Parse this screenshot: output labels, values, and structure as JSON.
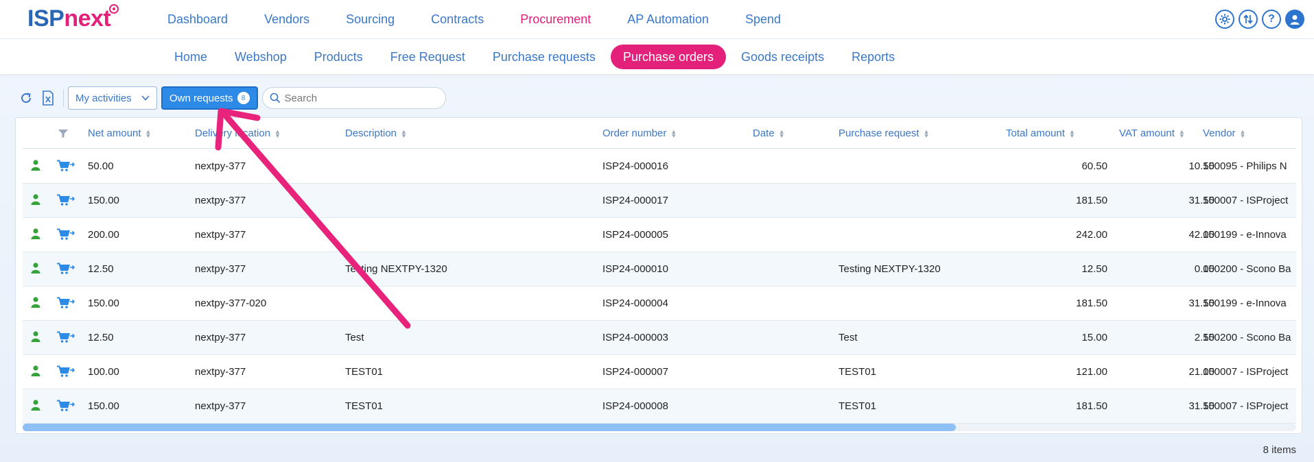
{
  "brand": {
    "isp": "ISP",
    "next": "next"
  },
  "main_nav": [
    "Dashboard",
    "Vendors",
    "Sourcing",
    "Contracts",
    "Procurement",
    "AP Automation",
    "Spend"
  ],
  "main_nav_active": "Procurement",
  "sub_nav": [
    "Home",
    "Webshop",
    "Products",
    "Free Request",
    "Purchase requests",
    "Purchase orders",
    "Goods receipts",
    "Reports"
  ],
  "sub_nav_active": "Purchase orders",
  "toolbar": {
    "activities_label": "My activities",
    "own_requests_label": "Own requests",
    "own_requests_count": "8",
    "search_placeholder": "Search"
  },
  "columns": {
    "net_amount": "Net amount",
    "delivery_location": "Delivery location",
    "description": "Description",
    "order_number": "Order number",
    "date": "Date",
    "purchase_request": "Purchase request",
    "total_amount": "Total amount",
    "vat_amount": "VAT amount",
    "vendor": "Vendor"
  },
  "rows": [
    {
      "net": "50.00",
      "loc": "nextpy-377",
      "desc": "",
      "order": "ISP24-000016",
      "date": "",
      "pr": "",
      "total": "60.50",
      "vat": "10.50",
      "vendor": "150095 - Philips N"
    },
    {
      "net": "150.00",
      "loc": "nextpy-377",
      "desc": "",
      "order": "ISP24-000017",
      "date": "",
      "pr": "",
      "total": "181.50",
      "vat": "31.50",
      "vendor": "150007 - ISProject"
    },
    {
      "net": "200.00",
      "loc": "nextpy-377",
      "desc": "",
      "order": "ISP24-000005",
      "date": "",
      "pr": "",
      "total": "242.00",
      "vat": "42.00",
      "vendor": "150199 - e-Innova"
    },
    {
      "net": "12.50",
      "loc": "nextpy-377",
      "desc": "Testing NEXTPY-1320",
      "order": "ISP24-000010",
      "date": "",
      "pr": "Testing NEXTPY-1320",
      "total": "12.50",
      "vat": "0.00",
      "vendor": "150200 - Scono Ba"
    },
    {
      "net": "150.00",
      "loc": "nextpy-377-020",
      "desc": "",
      "order": "ISP24-000004",
      "date": "",
      "pr": "",
      "total": "181.50",
      "vat": "31.50",
      "vendor": "150199 - e-Innova"
    },
    {
      "net": "12.50",
      "loc": "nextpy-377",
      "desc": "Test",
      "order": "ISP24-000003",
      "date": "",
      "pr": "Test",
      "total": "15.00",
      "vat": "2.50",
      "vendor": "150200 - Scono Ba"
    },
    {
      "net": "100.00",
      "loc": "nextpy-377",
      "desc": "TEST01",
      "order": "ISP24-000007",
      "date": "",
      "pr": "TEST01",
      "total": "121.00",
      "vat": "21.00",
      "vendor": "150007 - ISProject"
    },
    {
      "net": "150.00",
      "loc": "nextpy-377",
      "desc": "TEST01",
      "order": "ISP24-000008",
      "date": "",
      "pr": "TEST01",
      "total": "181.50",
      "vat": "31.50",
      "vendor": "150007 - ISProject"
    }
  ],
  "footer": {
    "items_count": "8 items"
  },
  "icons": {
    "user": "user-icon",
    "cart": "cart-arrow-icon",
    "settings": "gear-icon",
    "swap": "swap-icon",
    "help": "help-icon",
    "account": "account-icon"
  },
  "colors": {
    "brand_blue": "#2a66b6",
    "brand_pink": "#e3217a",
    "link": "#3a78c9",
    "user_green": "#35a33a",
    "cart_blue": "#2d8ae6",
    "annotation_arrow": "#e8237c"
  }
}
